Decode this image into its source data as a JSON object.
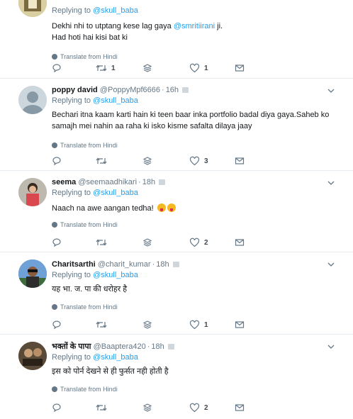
{
  "tweets": [
    {
      "name": "",
      "handle": "",
      "time": "",
      "replying_label": "Replying to",
      "replying_to": "@skull_baba",
      "text_lines": [
        "Dekhi nhi to utptang kese lag gaya ",
        "Had hoti hai kisi bat ki"
      ],
      "text_mention": "@smritiirani",
      "text_after_mention": " ji.",
      "translate": "Translate from Hindi",
      "replies": "",
      "retweets": "1",
      "likes": "1"
    },
    {
      "name": "poppy david",
      "handle": "@PoppyMpf6666",
      "time": "16h",
      "replying_label": "Replying to",
      "replying_to": "@skull_baba",
      "text": "Bechari itna kaam karti hain ki teen baar inka portfolio badal diya gaya.Saheb ko samajh mei nahin aa raha ki isko kisme safalta dilaya jaay",
      "translate": "Translate from Hindi",
      "replies": "",
      "retweets": "",
      "likes": "3"
    },
    {
      "name": "seema",
      "handle": "@seemaadhikari",
      "time": "18h",
      "replying_label": "Replying to",
      "replying_to": "@skull_baba",
      "text": "Naach na awe aangan tedha!",
      "translate": "Translate from Hindi",
      "replies": "",
      "retweets": "",
      "likes": "2"
    },
    {
      "name": "Charitsarthi",
      "handle": "@charit_kumar",
      "time": "18h",
      "replying_label": "Replying to",
      "replying_to": "@skull_baba",
      "text": "यह भा. ज. पा  की धरोहर है",
      "translate": "Translate from Hindi",
      "replies": "",
      "retweets": "",
      "likes": "1"
    },
    {
      "name": "भक्तों के पापा",
      "handle": "@Baaptera420",
      "time": "18h",
      "replying_label": "Replying to",
      "replying_to": "@skull_baba",
      "text": "इस को पोर्न देखने से ही फुर्सत नही होती है",
      "translate": "Translate from Hindi",
      "replies": "",
      "retweets": "",
      "likes": "2"
    }
  ],
  "colors": {
    "link": "#1da1f2",
    "muted": "#657786",
    "divider": "#e6ecf0"
  },
  "icons": [
    "reply-icon",
    "retweet-icon",
    "stack-icon",
    "heart-icon",
    "message-icon",
    "chevron-down-icon",
    "globe-icon"
  ]
}
